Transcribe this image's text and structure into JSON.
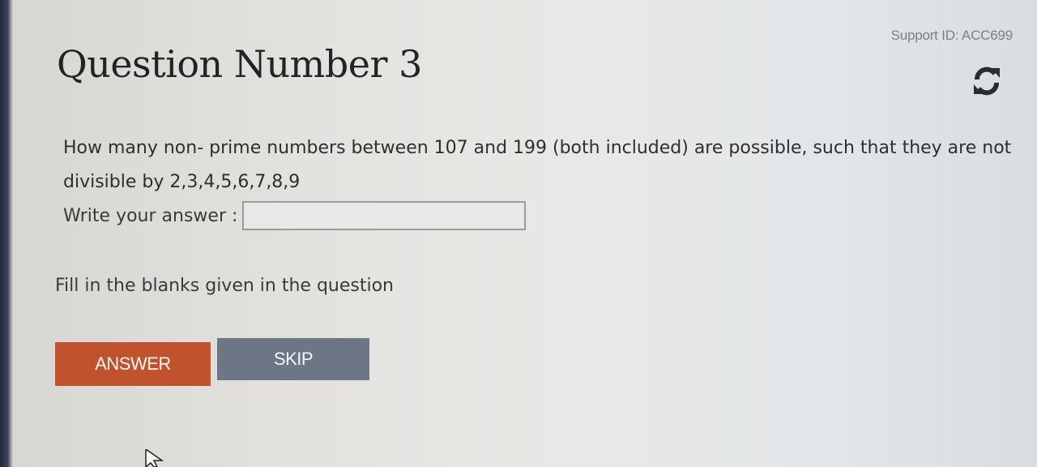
{
  "support": {
    "text": "Support ID: ACC699"
  },
  "header": {
    "title": "Question Number 3",
    "refresh_icon": "refresh-icon"
  },
  "question": {
    "text": "How many non- prime numbers between 107 and 199 (both included) are possible, such that they are not divisible by 2,3,4,5,6,7,8,9"
  },
  "answer": {
    "label": "Write your answer :",
    "value": ""
  },
  "hint": {
    "text": "Fill in the blanks given in the question"
  },
  "buttons": {
    "answer_label": "ANSWER",
    "skip_label": "SKIP"
  },
  "colors": {
    "answer_button": "#c0532e",
    "skip_button": "#6c7684"
  }
}
